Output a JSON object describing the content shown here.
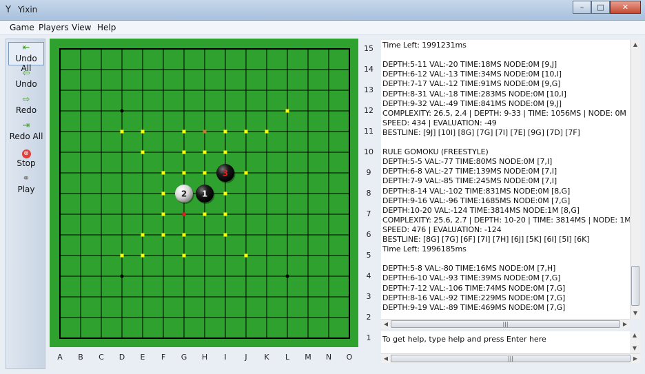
{
  "window": {
    "title": "Yixin",
    "minimize": "–",
    "maximize": "□",
    "close": "✕"
  },
  "menu": [
    "Game",
    "Players",
    "View",
    "Help"
  ],
  "toolbar": [
    {
      "label": "Undo All",
      "icon": "undo-all-icon",
      "glyph": "⇤"
    },
    {
      "label": "Undo",
      "icon": "undo-icon",
      "glyph": "⇦"
    },
    {
      "label": "Redo",
      "icon": "redo-icon",
      "glyph": "⇨"
    },
    {
      "label": "Redo All",
      "icon": "redo-all-icon",
      "glyph": "⇥"
    },
    {
      "label": "Stop",
      "icon": "stop-icon",
      "glyph": "⊗"
    },
    {
      "label": "Play",
      "icon": "play-icon",
      "glyph": "⚭"
    }
  ],
  "board": {
    "size": 15,
    "colors": {
      "board": "#2fa12f",
      "lines": "#000000",
      "hint": "#ffff00",
      "black": "#111111",
      "white": "#e6e6e6",
      "last_move_number": "#e02020"
    },
    "columns": [
      "A",
      "B",
      "C",
      "D",
      "E",
      "F",
      "G",
      "H",
      "I",
      "J",
      "K",
      "L",
      "M",
      "N",
      "O"
    ],
    "rows": [
      "15",
      "14",
      "13",
      "12",
      "11",
      "10",
      "9",
      "8",
      "7",
      "6",
      "5",
      "4",
      "3",
      "2",
      "1"
    ],
    "star_points": [
      "D12",
      "L4",
      "D4"
    ],
    "hint_points": [
      "L12",
      "D11",
      "E11",
      "G11",
      "I11",
      "J11",
      "K11",
      "E10",
      "G10",
      "H10",
      "I10",
      "F9",
      "G9",
      "H9",
      "J9",
      "F8",
      "I8",
      "F7",
      "H7",
      "I7",
      "E6",
      "F6",
      "G6",
      "I6",
      "D5",
      "E5",
      "G5",
      "J5"
    ],
    "marker_points": [
      {
        "point": "H11",
        "color": "#c87a2a"
      },
      {
        "point": "G7",
        "color": "#e02020"
      }
    ],
    "stones": [
      {
        "point": "H8",
        "color": "black",
        "number": "1"
      },
      {
        "point": "G8",
        "color": "white",
        "number": "2"
      },
      {
        "point": "I9",
        "color": "black",
        "number": "3"
      }
    ]
  },
  "log": [
    "Time Left: 1991231ms",
    "",
    "DEPTH:5-11 VAL:-20 TIME:18MS NODE:0M [9,J]",
    "DEPTH:6-12 VAL:-13 TIME:34MS NODE:0M [10,I]",
    "DEPTH:7-17 VAL:-12 TIME:91MS NODE:0M [9,G]",
    "DEPTH:8-31 VAL:-18 TIME:283MS NODE:0M [10,I]",
    "DEPTH:9-32 VAL:-49 TIME:841MS NODE:0M [9,J]",
    "COMPLEXITY: 26.5, 2.4 | DEPTH: 9-33 | TIME: 1056MS | NODE: 0M",
    "SPEED: 434 | EVALUATION: -49",
    "BESTLINE: [9J] [10I] [8G] [7G] [7I] [7E] [9G] [7D] [7F]",
    "",
    "RULE GOMOKU (FREESTYLE)",
    "DEPTH:5-5 VAL:-77 TIME:80MS NODE:0M [7,I]",
    "DEPTH:6-8 VAL:-27 TIME:139MS NODE:0M [7,I]",
    "DEPTH:7-9 VAL:-85 TIME:245MS NODE:0M [7,I]",
    "DEPTH:8-14 VAL:-102 TIME:831MS NODE:0M [8,G]",
    "DEPTH:9-16 VAL:-96 TIME:1685MS NODE:0M [7,G]",
    "DEPTH:10-20 VAL:-124 TIME:3814MS NODE:1M [8,G]",
    "COMPLEXITY: 25.6, 2.7 | DEPTH: 10-20 | TIME: 3814MS | NODE: 1M",
    "SPEED: 476 | EVALUATION: -124",
    "BESTLINE: [8G] [7G] [6F] [7I] [7H] [6J] [5K] [6I] [5I] [6K]",
    "Time Left: 1996185ms",
    "",
    "DEPTH:5-8 VAL:-80 TIME:16MS NODE:0M [7,H]",
    "DEPTH:6-10 VAL:-93 TIME:39MS NODE:0M [7,G]",
    "DEPTH:7-12 VAL:-106 TIME:74MS NODE:0M [7,G]",
    "DEPTH:8-16 VAL:-92 TIME:229MS NODE:0M [7,G]",
    "DEPTH:9-19 VAL:-89 TIME:469MS NODE:0M [7,G]"
  ],
  "command": {
    "value": "To get help, type help and press Enter here"
  },
  "scroll": {
    "thumb_glyph": "|||",
    "left": "◀",
    "right": "▶",
    "up": "▲",
    "down": "▼"
  }
}
